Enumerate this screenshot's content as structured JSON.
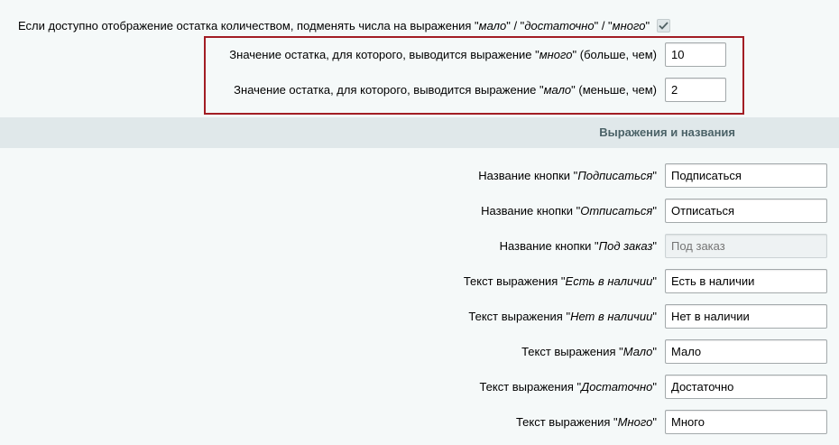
{
  "top_option": {
    "label_pre": "Если доступно отображение остатка количеством, подменять числа на выражения \"",
    "em1": "мало",
    "sep1": "\" / \"",
    "em2": "достаточно",
    "sep2": "\" / \"",
    "em3": "много",
    "label_post": "\"",
    "checked": true
  },
  "thresholds": [
    {
      "pre": "Значение остатка, для которого, выводится выражение \"",
      "em": "много",
      "post": "\" (больше, чем)",
      "value": "10"
    },
    {
      "pre": "Значение остатка, для которого, выводится выражение \"",
      "em": "мало",
      "post": "\" (меньше, чем)",
      "value": "2"
    }
  ],
  "section": {
    "title": "Выражения и названия"
  },
  "fields": [
    {
      "pre": "Название кнопки \"",
      "em": "Подписаться",
      "post": "\"",
      "value": "Подписаться",
      "placeholder": "",
      "disabled": false
    },
    {
      "pre": "Название кнопки \"",
      "em": "Отписаться",
      "post": "\"",
      "value": "Отписаться",
      "placeholder": "",
      "disabled": false
    },
    {
      "pre": "Название кнопки \"",
      "em": "Под заказ",
      "post": "\"",
      "value": "",
      "placeholder": "Под заказ",
      "disabled": true
    },
    {
      "pre": "Текст выражения \"",
      "em": "Есть в наличии",
      "post": "\"",
      "value": "Есть в наличии",
      "placeholder": "",
      "disabled": false
    },
    {
      "pre": "Текст выражения \"",
      "em": "Нет в наличии",
      "post": "\"",
      "value": "Нет в наличии",
      "placeholder": "",
      "disabled": false
    },
    {
      "pre": "Текст выражения \"",
      "em": "Мало",
      "post": "\"",
      "value": "Мало",
      "placeholder": "",
      "disabled": false
    },
    {
      "pre": "Текст выражения \"",
      "em": "Достаточно",
      "post": "\"",
      "value": "Достаточно",
      "placeholder": "",
      "disabled": false
    },
    {
      "pre": "Текст выражения \"",
      "em": "Много",
      "post": "\"",
      "value": "Много",
      "placeholder": "",
      "disabled": false
    }
  ]
}
